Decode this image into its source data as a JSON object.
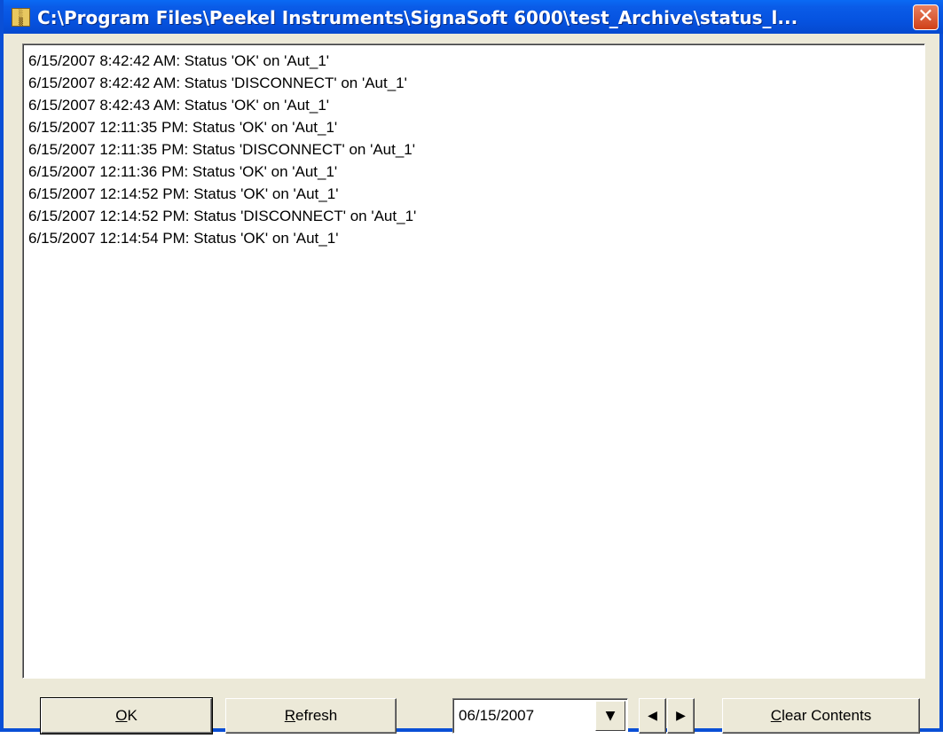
{
  "window": {
    "title": "C:\\Program Files\\Peekel Instruments\\SignaSoft 6000\\test_Archive\\status_l...",
    "icon": "app-icon"
  },
  "log": {
    "lines": [
      "6/15/2007 8:42:42 AM: Status 'OK' on 'Aut_1'",
      "6/15/2007 8:42:42 AM: Status 'DISCONNECT' on 'Aut_1'",
      "6/15/2007 8:42:43 AM: Status 'OK' on 'Aut_1'",
      "6/15/2007 12:11:35 PM: Status 'OK' on 'Aut_1'",
      "6/15/2007 12:11:35 PM: Status 'DISCONNECT' on 'Aut_1'",
      "6/15/2007 12:11:36 PM: Status 'OK' on 'Aut_1'",
      "6/15/2007 12:14:52 PM: Status 'OK' on 'Aut_1'",
      "6/15/2007 12:14:52 PM: Status 'DISCONNECT' on 'Aut_1'",
      "6/15/2007 12:14:54 PM: Status 'OK' on 'Aut_1'"
    ]
  },
  "buttons": {
    "ok_first": "O",
    "ok_rest": "K",
    "refresh_first": "R",
    "refresh_rest": "efresh",
    "clear_first": "C",
    "clear_rest": "lear Contents"
  },
  "date": {
    "value": "06/15/2007"
  },
  "colors": {
    "titlebar": "#0653e0",
    "face": "#ece9d8",
    "close": "#d04018"
  }
}
